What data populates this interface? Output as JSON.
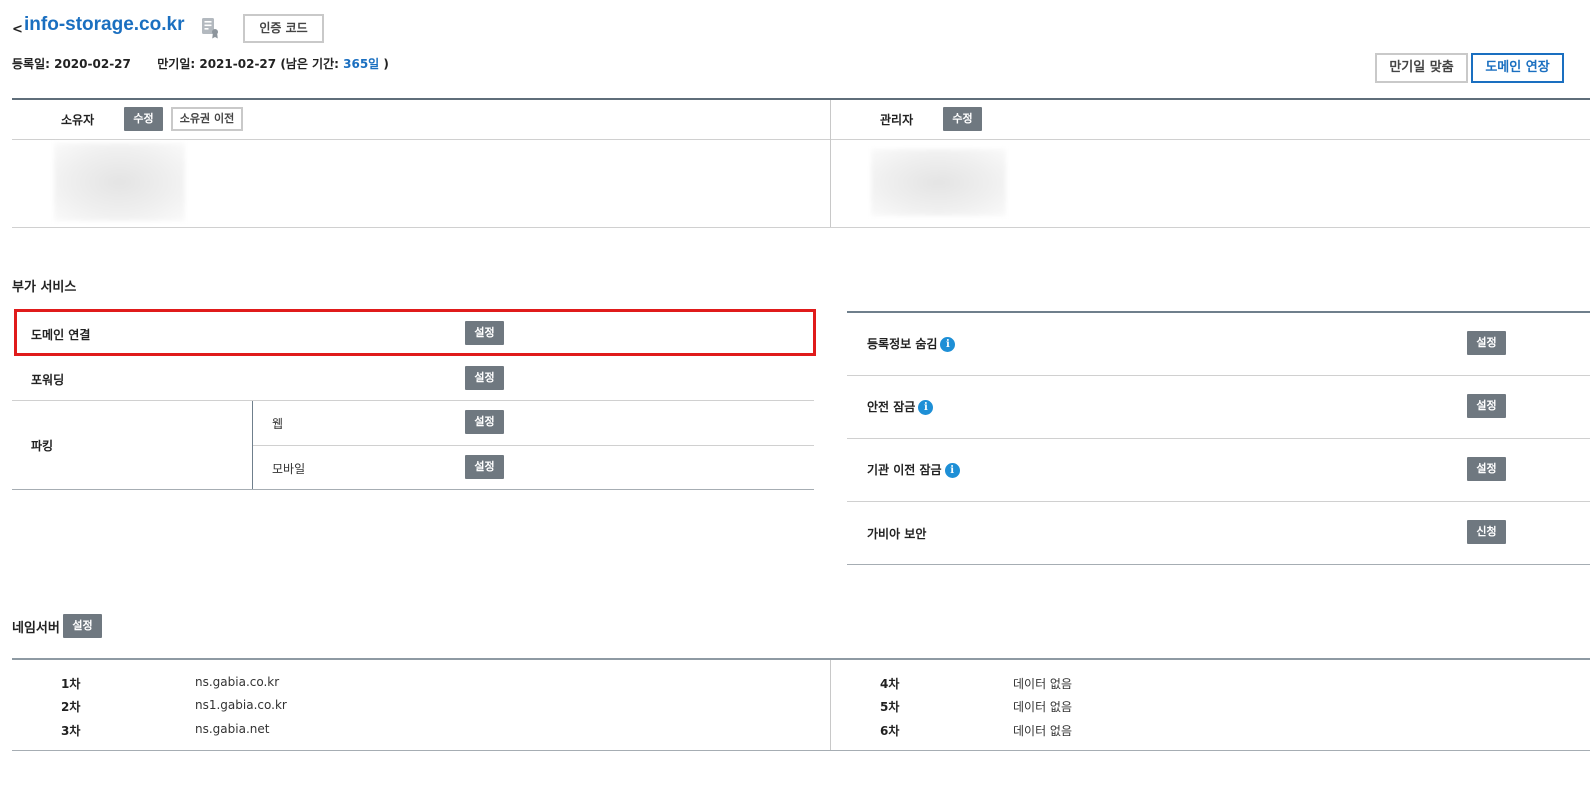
{
  "header": {
    "back_arrow": "<",
    "domain": "info-storage.co.kr",
    "auth_code_label": "인증 코드",
    "reg_date_label": "등록일:",
    "reg_date": "2020-02-27",
    "exp_date_label": "만기일:",
    "exp_date": "2021-02-27",
    "remaining_prefix": "(남은 기간:",
    "remaining_days": "365일",
    "remaining_suffix": ")",
    "match_expiry_label": "만기일 맞춤",
    "renew_label": "도메인 연장"
  },
  "owner": {
    "label": "소유자",
    "edit_label": "수정",
    "transfer_label": "소유권 이전"
  },
  "admin": {
    "label": "관리자",
    "edit_label": "수정"
  },
  "addon": {
    "title": "부가 서비스",
    "left": [
      {
        "label": "도메인 연결",
        "button": "설정"
      },
      {
        "label": "포워딩",
        "button": "설정"
      }
    ],
    "parking": {
      "label": "파킹",
      "items": [
        {
          "label": "웹",
          "button": "설정"
        },
        {
          "label": "모바일",
          "button": "설정"
        }
      ]
    },
    "right": [
      {
        "label": "등록정보 숨김",
        "button": "설정",
        "info": "i"
      },
      {
        "label": "안전 잠금",
        "button": "설정",
        "info": "i"
      },
      {
        "label": "기관 이전 잠금",
        "button": "설정",
        "info": "i"
      },
      {
        "label": "가비아 보안",
        "button": "신청"
      }
    ]
  },
  "nameserver": {
    "title": "네임서버",
    "button": "설정",
    "left": [
      {
        "rank": "1차",
        "value": "ns.gabia.co.kr"
      },
      {
        "rank": "2차",
        "value": "ns1.gabia.co.kr"
      },
      {
        "rank": "3차",
        "value": "ns.gabia.net"
      }
    ],
    "right": [
      {
        "rank": "4차",
        "value": "데이터 없음"
      },
      {
        "rank": "5차",
        "value": "데이터 없음"
      },
      {
        "rank": "6차",
        "value": "데이터 없음"
      }
    ]
  },
  "colors": {
    "accent": "#1a6fc0",
    "button_dark": "#6f7880",
    "highlight": "#e01b1b",
    "info": "#1e8fd6"
  }
}
